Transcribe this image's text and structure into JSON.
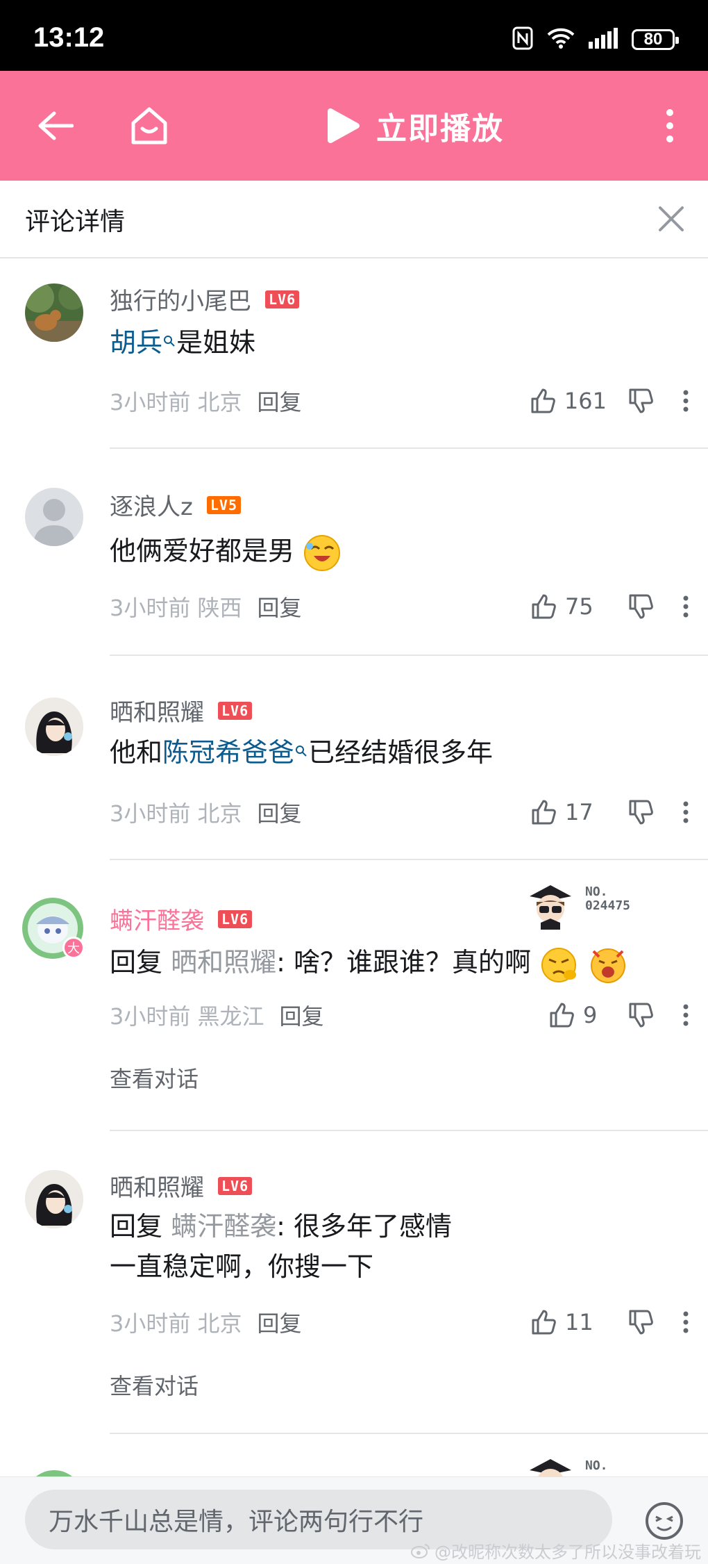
{
  "status_bar": {
    "time": "13:12",
    "battery": "80"
  },
  "top_bar": {
    "play_now": "立即播放"
  },
  "detail_header": {
    "title": "评论详情"
  },
  "comments": [
    {
      "username": "独行的小尾巴",
      "level": "LV6",
      "content": {
        "link": "胡兵",
        "text": "是姐妹"
      },
      "time_location": "3小时前 北京",
      "reply": "回复",
      "likes": "161"
    },
    {
      "username": "逐浪人z",
      "level": "LV5",
      "content": {
        "text": "他俩爱好都是男"
      },
      "time_location": "3小时前 陕西",
      "reply": "回复",
      "likes": "75"
    },
    {
      "username": "晒和照耀",
      "level": "LV6",
      "content": {
        "pre": "他和",
        "link": "陈冠希爸爸",
        "text": "已经结婚很多年"
      },
      "time_location": "3小时前 北京",
      "reply": "回复",
      "likes": "17"
    },
    {
      "username": "螨汗醛袭",
      "level": "LV6",
      "avatar_badge": "大",
      "fan_badge": {
        "line1": "NO.",
        "line2": "024475"
      },
      "content": {
        "reply_prefix": "回复 ",
        "reply_to": "晒和照耀",
        "text": ": 啥？谁跟谁？真的啊"
      },
      "time_location": "3小时前 黑龙江",
      "reply": "回复",
      "likes": "9",
      "view_conversation": "查看对话"
    },
    {
      "username": "晒和照耀",
      "level": "LV6",
      "content": {
        "reply_prefix": "回复 ",
        "reply_to": "螨汗醛袭",
        "text": ": 很多年了感情一直稳定啊，你搜一下"
      },
      "time_location": "3小时前 北京",
      "reply": "回复",
      "likes": "11",
      "view_conversation": "查看对话"
    },
    {
      "username": "螨汗醛袭",
      "fan_badge": {
        "line1": "NO."
      }
    }
  ],
  "bottom_bar": {
    "placeholder": "万水千山总是情，评论两句行不行",
    "watermark": "@改昵称次数太多了所以没事改着玩"
  },
  "colors": {
    "brand_pink": "#fb7299",
    "link_blue": "#0b5b8f",
    "lv6": "#ee4e55",
    "lv5": "#ff6c00"
  }
}
